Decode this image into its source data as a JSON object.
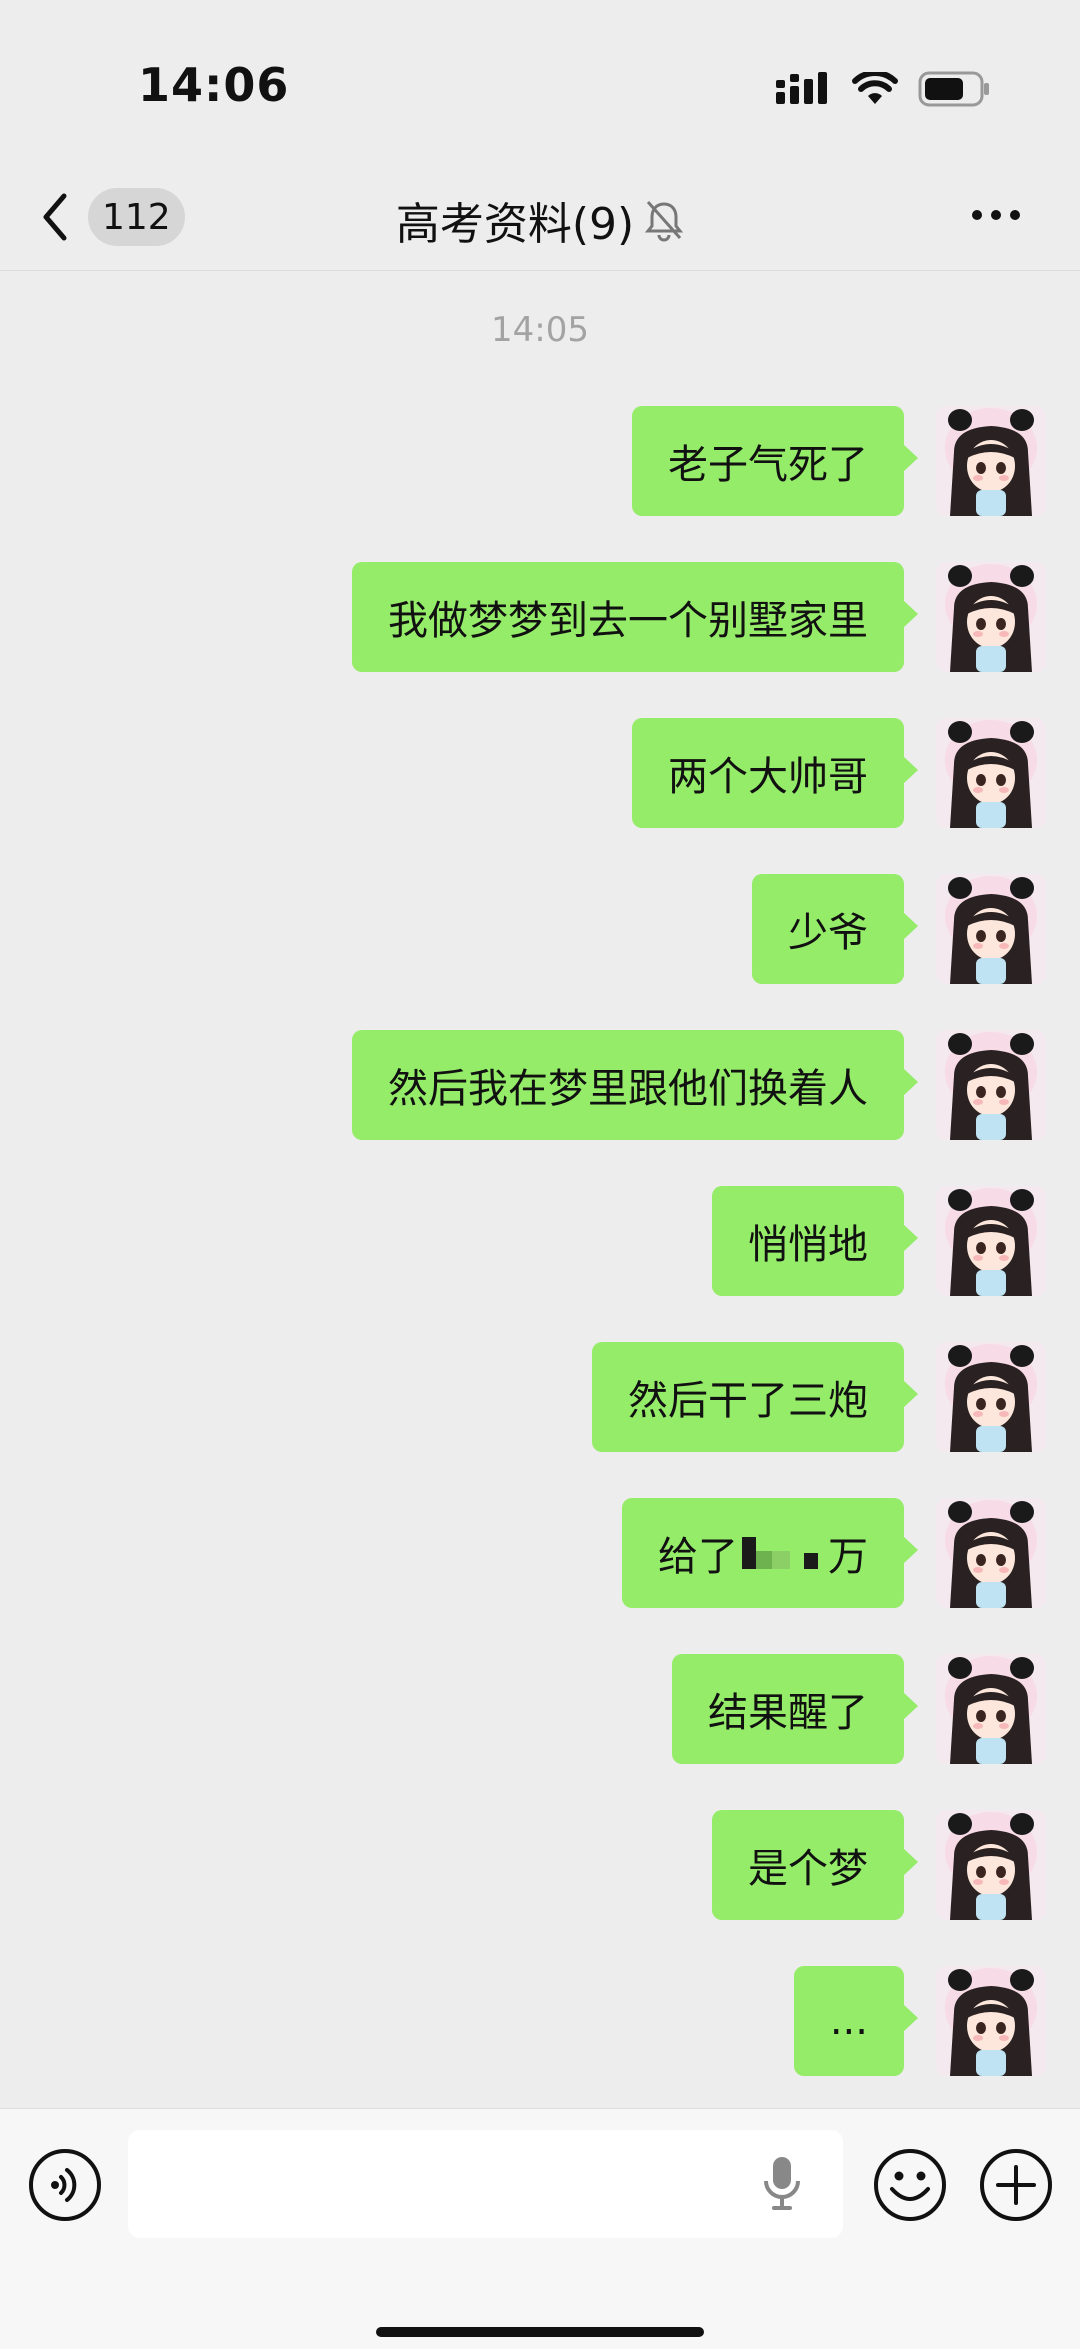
{
  "status_bar": {
    "time": "14:06"
  },
  "header": {
    "back_count": "112",
    "title": "高考资料(9)"
  },
  "chat": {
    "timestamp": "14:05",
    "messages": [
      {
        "text": "老子气死了"
      },
      {
        "text": "我做梦梦到去一个别墅家里"
      },
      {
        "text": "两个大帅哥"
      },
      {
        "text": "少爷"
      },
      {
        "text": "然后我在梦里跟他们换着人"
      },
      {
        "text": "悄悄地"
      },
      {
        "text": "然后干了三炮"
      },
      {
        "text_before": "给了",
        "text_after": "万",
        "redacted": true
      },
      {
        "text": "结果醒了"
      },
      {
        "text": "是个梦"
      },
      {
        "text": "..."
      }
    ]
  },
  "input_bar": {
    "placeholder": ""
  },
  "colors": {
    "background": "#ededed",
    "bubble": "#95ec69",
    "header_badge": "#d6d6d6"
  },
  "icons": [
    "chevron-left-icon",
    "mute-bell-icon",
    "more-icon",
    "voice-icon",
    "mic-icon",
    "emoji-icon",
    "plus-icon",
    "signal-icon",
    "wifi-icon",
    "battery-icon"
  ]
}
